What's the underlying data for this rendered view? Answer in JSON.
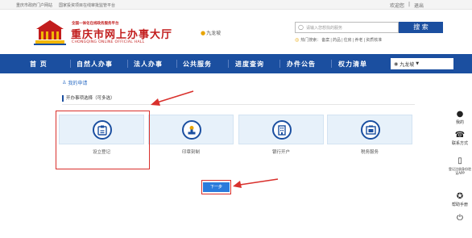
{
  "topbar": {
    "left_links": [
      "重庆市政府门户网站",
      "国家投资项目在线审批监管平台"
    ],
    "welcome": "欢迎您",
    "separator": "|",
    "logout": "退出"
  },
  "header": {
    "logo_small": "全国一体化在线政务服务平台",
    "logo_title": "重庆市网上办事大厅",
    "logo_en": "CHONGQING ONLINE OFFICIAL HALL",
    "region": "九龙坡",
    "search_placeholder": "请输入您想找的服务",
    "search_button": "搜 索",
    "hot_label": "热门搜索：",
    "hot_items": [
      "备案",
      "药品",
      "住房",
      "养老",
      "资质核准"
    ]
  },
  "nav": {
    "items": [
      "首 页",
      "自然人办事",
      "法人办事",
      "公共服务",
      "进度查询",
      "办件公告",
      "权力清单"
    ],
    "location": "九龙坡"
  },
  "breadcrumb": {
    "label": "我的申请"
  },
  "section": {
    "title": "开办事项选择（可多选）"
  },
  "cards": [
    {
      "label": "设立登记",
      "icon": "clipboard-icon"
    },
    {
      "label": "印章刻制",
      "icon": "seal-icon"
    },
    {
      "label": "银行开户",
      "icon": "bank-building-icon"
    },
    {
      "label": "税务服务",
      "icon": "tax-document-icon"
    }
  ],
  "next_button": "下一步",
  "sidebar": [
    {
      "label": "我的",
      "icon": "user-icon"
    },
    {
      "label": "联系方式",
      "icon": "phone-icon"
    },
    {
      "label": "登记注册身份验证APP",
      "icon": "mobile-icon"
    },
    {
      "label": "帮助手册",
      "icon": "help-icon"
    },
    {
      "label": "",
      "icon": "power-icon"
    }
  ],
  "colors": {
    "brand_red": "#c21d1d",
    "nav_blue": "#1b4fa0",
    "card_bg": "#e7f1fa",
    "highlight_red": "#d9302c",
    "button_blue": "#2b7bdc"
  }
}
